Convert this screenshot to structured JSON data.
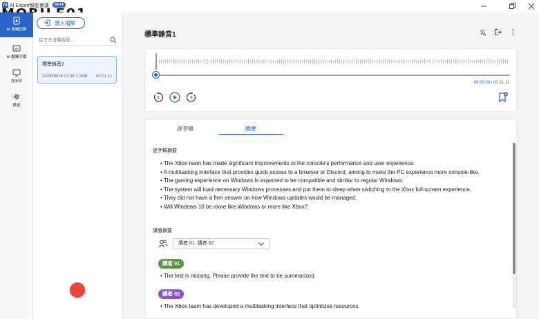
{
  "app": {
    "logo_text": "m",
    "title": "AI Expert智能會議",
    "beta": "BETA",
    "watermark": "MOBILE01"
  },
  "rail": {
    "items": [
      {
        "label": "AI 會議記錄",
        "icon": "document-mic-icon",
        "active": true
      },
      {
        "label": "AI 翻譯字幕",
        "icon": "subtitles-icon",
        "active": false
      },
      {
        "label": "浮水印",
        "icon": "monitor-icon",
        "active": false
      },
      {
        "label": "設定",
        "icon": "gear-icon",
        "active": false
      }
    ]
  },
  "list": {
    "import_label": "匯入檔案",
    "search_placeholder": "在下方清單搜尋...",
    "recordings": [
      {
        "title": "標準錄音1",
        "meta": "2025/08/26 23:36 2.2MB",
        "duration": "00:01:11"
      }
    ]
  },
  "main": {
    "title": "標準錄音1",
    "header_icons": [
      "translate-icon",
      "export-icon",
      "more-vertical-icon"
    ]
  },
  "player": {
    "current_time": "00:00:00",
    "separator": "/",
    "total_time": "00:01:11",
    "progress": 0
  },
  "tabs": [
    {
      "label": "逐字稿",
      "active": false
    },
    {
      "label": "摘要",
      "active": true
    }
  ],
  "summary": {
    "heading": "逐字稿摘要",
    "bullets": [
      "The Xbox team has made significant improvements to the console's performance and user experience.",
      "A multitasking interface that provides quick access to a browser or Discord, aiming to make the PC experience more console-like.",
      "The gaming experience on Windows is expected to be compatible and similar to regular Windows.",
      "The system will load necessary Windows processes and put them to sleep when switching to the Xbox full-screen experience.",
      "They did not have a firm answer on how Windows updates would be managed.",
      "Will Windows 10 be more like Windows or more like Xbox?"
    ]
  },
  "speakers": {
    "heading": "講者摘要",
    "select_value": "講者 01, 講者 02",
    "entries": [
      {
        "name": "講者 01",
        "color": "#5d9447",
        "text": "The text is missing. Please provide the text to be summarized."
      },
      {
        "name": "講者 02",
        "color": "#8a57c9",
        "text": "The Xbox team has developed a multitasking interface that optimizes resources."
      }
    ]
  },
  "colors": {
    "accent": "#2b63c6",
    "record": "#e8453c"
  }
}
